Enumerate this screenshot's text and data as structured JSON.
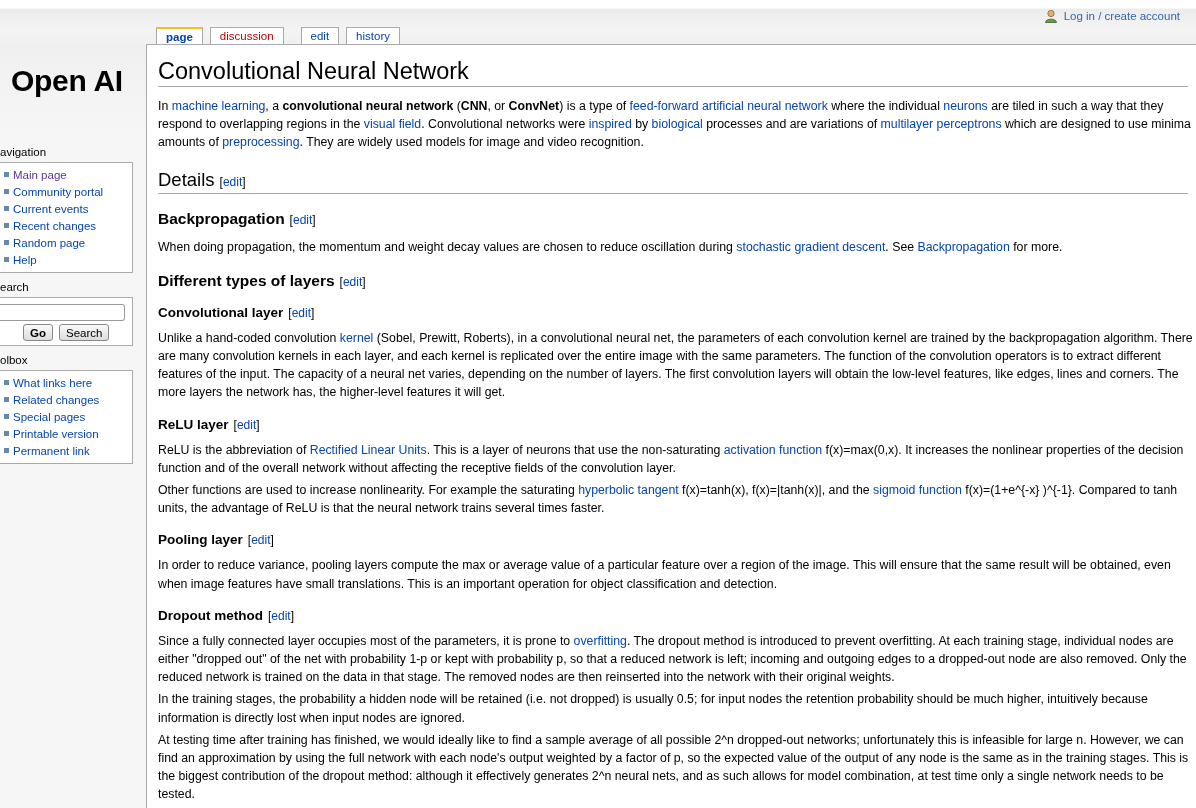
{
  "personal": {
    "login": "Log in / create account"
  },
  "tabs": [
    {
      "label": "page",
      "selected": true,
      "missing": false
    },
    {
      "label": "discussion",
      "selected": false,
      "missing": true
    },
    {
      "label": "edit",
      "selected": false,
      "missing": false
    },
    {
      "label": "history",
      "selected": false,
      "missing": false
    }
  ],
  "logo": "Open AI",
  "sidebar": {
    "navigation": {
      "title": "avigation",
      "items": [
        {
          "label": "Main page",
          "visited": true
        },
        {
          "label": "Community portal",
          "visited": false
        },
        {
          "label": "Current events",
          "visited": false
        },
        {
          "label": "Recent changes",
          "visited": false
        },
        {
          "label": "Random page",
          "visited": false
        },
        {
          "label": "Help",
          "visited": false
        }
      ]
    },
    "search": {
      "title": "earch",
      "go": "Go",
      "button": "Search"
    },
    "toolbox": {
      "title": "olbox",
      "items": [
        {
          "label": "What links here",
          "visited": false
        },
        {
          "label": "Related changes",
          "visited": false
        },
        {
          "label": "Special pages",
          "visited": false
        },
        {
          "label": "Printable version",
          "visited": false
        },
        {
          "label": "Permanent link",
          "visited": false
        }
      ]
    }
  },
  "article": {
    "title": "Convolutional Neural Network",
    "blocks": [
      {
        "kind": "p",
        "parts": [
          {
            "kind": "text",
            "text": "In "
          },
          {
            "kind": "link",
            "text": "machine learning"
          },
          {
            "kind": "text",
            "text": ", a **convolutional neural network** (**CNN**, or **ConvNet**) is a type of "
          },
          {
            "kind": "link",
            "text": "feed-forward artificial neural network"
          },
          {
            "kind": "text",
            "text": " where the individual "
          },
          {
            "kind": "link",
            "text": "neurons"
          },
          {
            "kind": "text",
            "text": " are tiled in such a way that they respond to overlapping regions in the "
          },
          {
            "kind": "link",
            "text": "visual field"
          },
          {
            "kind": "text",
            "text": ". Convolutional networks were "
          },
          {
            "kind": "link",
            "text": "inspired"
          },
          {
            "kind": "text",
            "text": " by "
          },
          {
            "kind": "link",
            "text": "biological"
          },
          {
            "kind": "text",
            "text": " processes and are variations of "
          },
          {
            "kind": "link",
            "text": "multilayer perceptrons"
          },
          {
            "kind": "text",
            "text": " which are designed to use minima amounts of "
          },
          {
            "kind": "link",
            "text": "preprocessing"
          },
          {
            "kind": "text",
            "text": ". They are widely used models for image and video recognition."
          }
        ]
      },
      {
        "kind": "h2",
        "text": "Details",
        "edit": [
          "[",
          "edit",
          "]"
        ]
      },
      {
        "kind": "h3",
        "text": "Backpropagation",
        "edit": [
          "[",
          "edit",
          "]"
        ]
      },
      {
        "kind": "p",
        "parts": [
          {
            "kind": "text",
            "text": "When doing propagation, the momentum and weight decay values are chosen to reduce oscillation during "
          },
          {
            "kind": "link",
            "text": "stochastic gradient descent"
          },
          {
            "kind": "text",
            "text": ". See "
          },
          {
            "kind": "link",
            "text": "Backpropagation"
          },
          {
            "kind": "text",
            "text": " for more."
          }
        ]
      },
      {
        "kind": "h3",
        "text": "Different types of layers",
        "edit": [
          "[",
          "edit",
          "]"
        ]
      },
      {
        "kind": "h4",
        "text": "Convolutional layer",
        "edit": [
          "[",
          "edit",
          "]"
        ]
      },
      {
        "kind": "p",
        "parts": [
          {
            "kind": "text",
            "text": "Unlike a hand-coded convolution "
          },
          {
            "kind": "link",
            "text": "kernel"
          },
          {
            "kind": "text",
            "text": " (Sobel, Prewitt, Roberts), in a convolutional neural net, the parameters of each convolution kernel are trained by the backpropagation algorithm. There are many convolution kernels in each layer, and each kernel is replicated over the entire image with the same parameters. The function of the convolution operators is to extract different features of the input. The capacity of a neural net varies, depending on the number of layers. The first convolution layers will obtain the low-level features, like edges, lines and corners. The more layers the network has, the higher-level features it will get."
          }
        ]
      },
      {
        "kind": "h4",
        "text": "ReLU layer",
        "edit": [
          "[",
          "edit",
          "]"
        ]
      },
      {
        "kind": "p",
        "parts": [
          {
            "kind": "text",
            "text": "ReLU is the abbreviation of "
          },
          {
            "kind": "link",
            "text": "Rectified Linear Units"
          },
          {
            "kind": "text",
            "text": ". This is a layer of neurons that use the non-saturating "
          },
          {
            "kind": "link",
            "text": "activation function"
          },
          {
            "kind": "text",
            "text": " f(x)=max(0,x). It increases the nonlinear properties of the decision function and of the overall network without affecting the receptive fields of the convolution layer."
          }
        ]
      },
      {
        "kind": "p",
        "parts": [
          {
            "kind": "text",
            "text": "Other functions are used to increase nonlinearity. For example the saturating "
          },
          {
            "kind": "link",
            "text": "hyperbolic tangent"
          },
          {
            "kind": "text",
            "text": " f(x)=tanh(x), f(x)=|tanh(x)|, and the "
          },
          {
            "kind": "link",
            "text": "sigmoid function"
          },
          {
            "kind": "text",
            "text": " f(x)=(1+e^{-x} )^{-1}. Compared to tanh units, the advantage of ReLU is that the neural network trains several times faster."
          }
        ]
      },
      {
        "kind": "h4",
        "text": "Pooling layer",
        "edit": [
          "[",
          "edit",
          "]"
        ]
      },
      {
        "kind": "p",
        "parts": [
          {
            "kind": "text",
            "text": "In order to reduce variance, pooling layers compute the max or average value of a particular feature over a region of the image. This will ensure that the same result will be obtained, even when image features have small translations. This is an important operation for object classification and detection."
          }
        ]
      },
      {
        "kind": "h4",
        "text": "Dropout method",
        "edit": [
          "[",
          "edit",
          "]"
        ]
      },
      {
        "kind": "p",
        "parts": [
          {
            "kind": "text",
            "text": "Since a fully connected layer occupies most of the parameters, it is prone to "
          },
          {
            "kind": "link",
            "text": "overfitting"
          },
          {
            "kind": "text",
            "text": ". The dropout method is introduced to prevent overfitting. At each training stage, individual nodes are either \"dropped out\" of the net with probability 1-p or kept with probability p, so that a reduced network is left; incoming and outgoing edges to a dropped-out node are also removed. Only the reduced network is trained on the data in that stage. The removed nodes are then reinserted into the network with their original weights."
          }
        ]
      },
      {
        "kind": "p",
        "parts": [
          {
            "kind": "text",
            "text": "In the training stages, the probability a hidden node will be retained (i.e. not dropped) is usually 0.5; for input nodes the retention probability should be much higher, intuitively because information is directly lost when input nodes are ignored."
          }
        ]
      },
      {
        "kind": "p",
        "parts": [
          {
            "kind": "text",
            "text": "At testing time after training has finished, we would ideally like to find a sample average of all possible 2^n dropped-out networks; unfortunately this is infeasible for large n. However, we can find an approximation by using the full network with each node's output weighted by a factor of p, so the expected value of the output of any node is the same as in the training stages. This is the biggest contribution of the dropout method: although it effectively generates 2^n neural nets, and as such allows for model combination, at test time only a single network needs to be tested."
          }
        ]
      }
    ]
  }
}
